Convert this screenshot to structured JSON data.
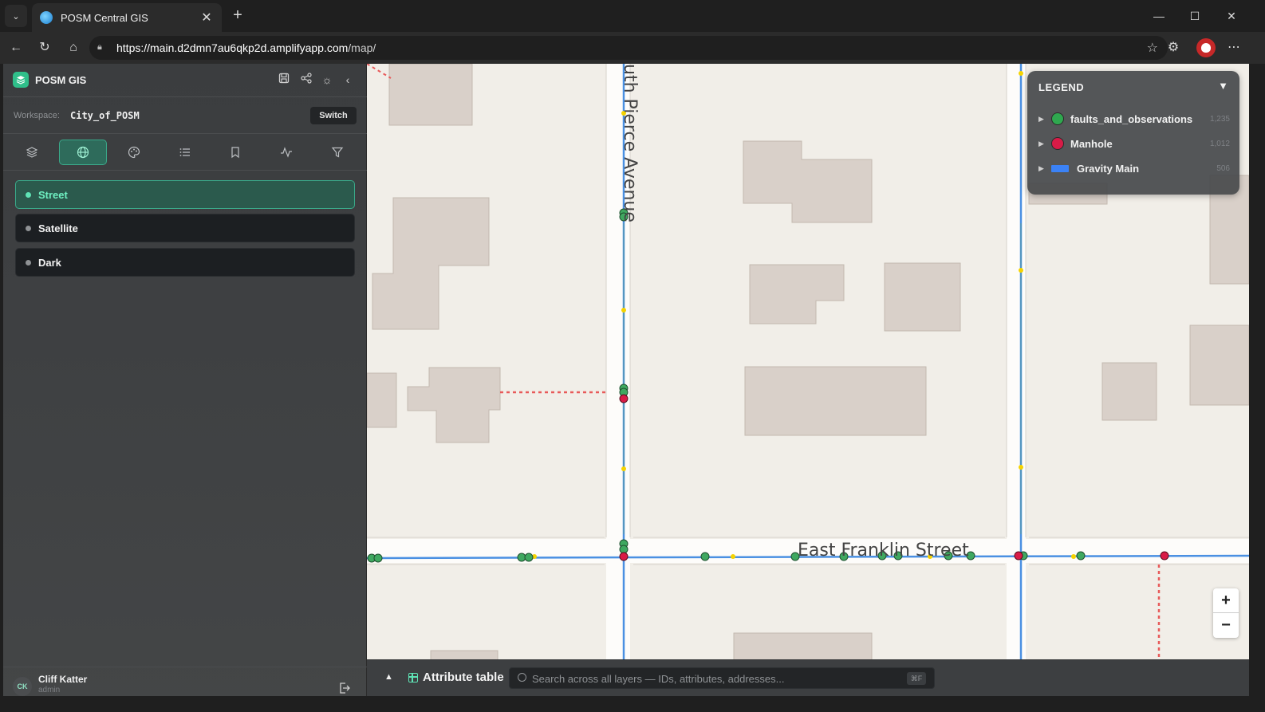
{
  "browser": {
    "tab_title": "POSM Central GIS",
    "url_host": "https://main.d2dmn7au6qkp2d.amplifyapp.com",
    "url_path": "/map/"
  },
  "app": {
    "name": "POSM GIS",
    "workspace_label": "Workspace:",
    "workspace_value": "City_of_POSM",
    "switch_label": "Switch"
  },
  "basemaps": [
    {
      "label": "Street",
      "active": true
    },
    {
      "label": "Satellite",
      "active": false
    },
    {
      "label": "Dark",
      "active": false
    }
  ],
  "user": {
    "initials": "CK",
    "name": "Cliff Katter",
    "role": "admin"
  },
  "map": {
    "street_vertical": "uth Pierce Avenue",
    "street_horizontal": "East Franklin Street"
  },
  "legend": {
    "title": "LEGEND",
    "items": [
      {
        "name": "faults_and_observations",
        "count": "1,235",
        "color": "#2fa84f",
        "shape": "circle"
      },
      {
        "name": "Manhole",
        "count": "1,012",
        "color": "#d81b47",
        "shape": "circle"
      },
      {
        "name": "Gravity Main",
        "count": "506",
        "color": "#3b82f6",
        "shape": "line"
      }
    ]
  },
  "attribute_bar": {
    "title": "Attribute table",
    "search_placeholder": "Search across all layers — IDs, attributes, addresses...",
    "shortcut": "⌘F"
  },
  "colors": {
    "accent": "#3aa889",
    "pipe": "#4a90e2",
    "manhole": "#d81b47",
    "fault": "#2fa84f",
    "vertex": "#f5d300"
  }
}
